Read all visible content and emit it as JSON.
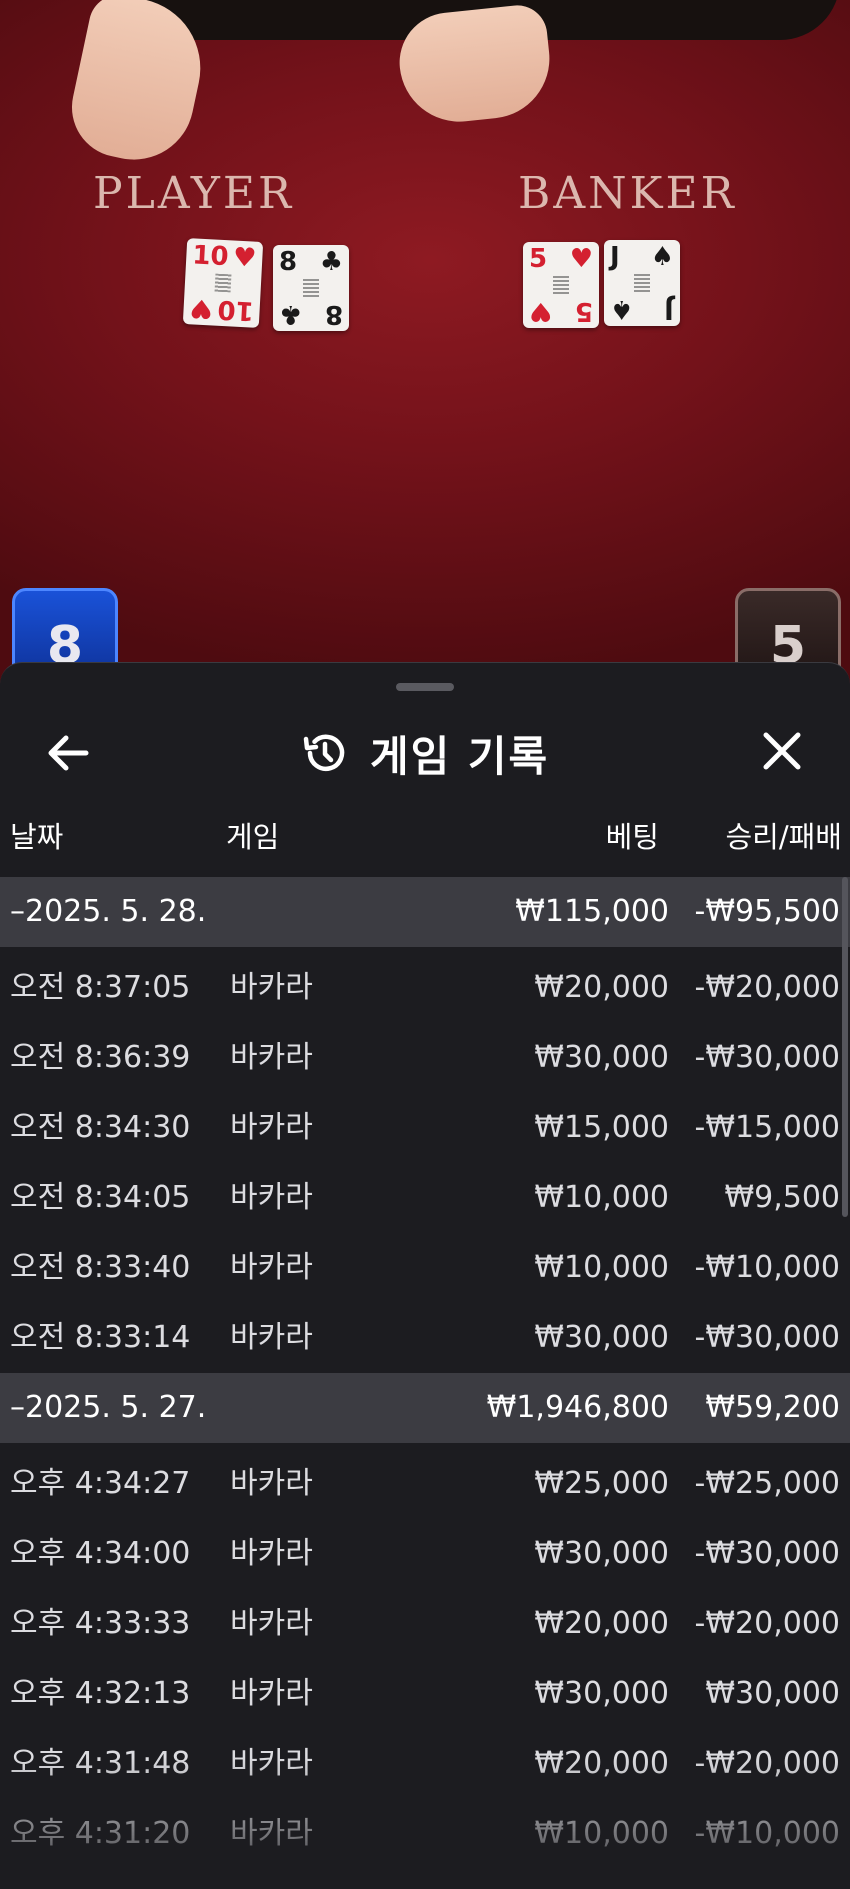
{
  "table": {
    "player_label": "PLAYER",
    "banker_label": "BANKER",
    "player_cards": [
      {
        "rank": "10",
        "suit": "♥",
        "color": "#d42030"
      },
      {
        "rank": "8",
        "suit": "♣",
        "color": "#1a1a1a"
      }
    ],
    "banker_cards": [
      {
        "rank": "5",
        "suit": "♥",
        "color": "#d42030"
      },
      {
        "rank": "J",
        "suit": "♠",
        "color": "#1a1a1a"
      }
    ],
    "player_score": "8",
    "banker_score": "5"
  },
  "sheet": {
    "title": "게임 기록",
    "back_icon": "arrow-left-icon",
    "history_icon": "history-icon",
    "close_icon": "close-icon",
    "columns": {
      "date": "날짜",
      "game": "게임",
      "bet": "베팅",
      "result": "승리/패배"
    },
    "groups": [
      {
        "date": "–2025. 5. 28.",
        "bet": "₩115,000",
        "result": "-₩95,500",
        "items": [
          {
            "time": "오전 8:37:05",
            "game": "바카라",
            "bet": "₩20,000",
            "result": "-₩20,000"
          },
          {
            "time": "오전 8:36:39",
            "game": "바카라",
            "bet": "₩30,000",
            "result": "-₩30,000"
          },
          {
            "time": "오전 8:34:30",
            "game": "바카라",
            "bet": "₩15,000",
            "result": "-₩15,000"
          },
          {
            "time": "오전 8:34:05",
            "game": "바카라",
            "bet": "₩10,000",
            "result": "₩9,500"
          },
          {
            "time": "오전 8:33:40",
            "game": "바카라",
            "bet": "₩10,000",
            "result": "-₩10,000"
          },
          {
            "time": "오전 8:33:14",
            "game": "바카라",
            "bet": "₩30,000",
            "result": "-₩30,000"
          }
        ]
      },
      {
        "date": "–2025. 5. 27.",
        "bet": "₩1,946,800",
        "result": "₩59,200",
        "items": [
          {
            "time": "오후 4:34:27",
            "game": "바카라",
            "bet": "₩25,000",
            "result": "-₩25,000"
          },
          {
            "time": "오후 4:34:00",
            "game": "바카라",
            "bet": "₩30,000",
            "result": "-₩30,000"
          },
          {
            "time": "오후 4:33:33",
            "game": "바카라",
            "bet": "₩20,000",
            "result": "-₩20,000"
          },
          {
            "time": "오후 4:32:13",
            "game": "바카라",
            "bet": "₩30,000",
            "result": "₩30,000"
          },
          {
            "time": "오후 4:31:48",
            "game": "바카라",
            "bet": "₩20,000",
            "result": "-₩20,000"
          },
          {
            "time": "오후 4:31:20",
            "game": "바카라",
            "bet": "₩10,000",
            "result": "-₩10,000"
          }
        ]
      }
    ]
  },
  "colors": {
    "sheet_bg": "#1c1c20",
    "group_row_bg": "#3c3c42",
    "felt": "#74121a",
    "player_blue": "#1a52d8"
  }
}
